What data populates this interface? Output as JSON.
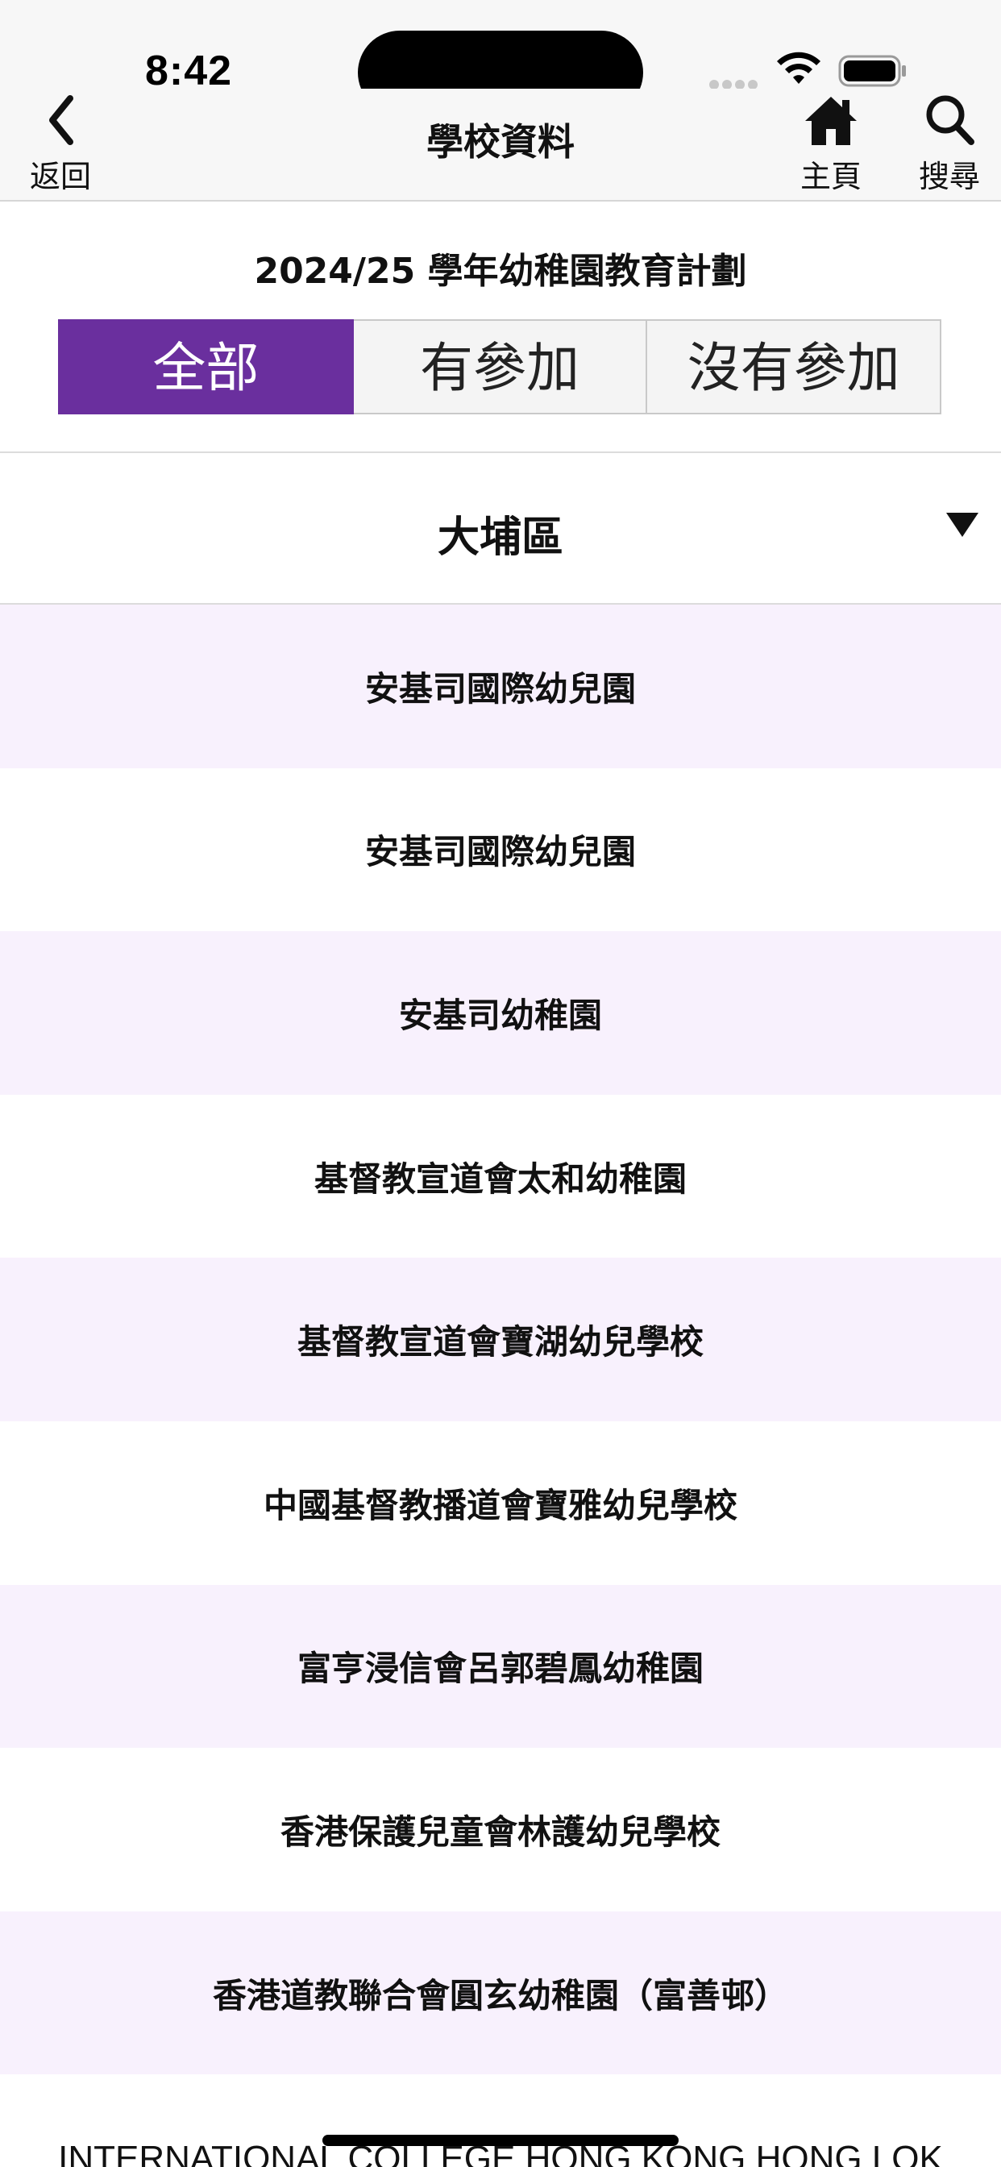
{
  "status_bar": {
    "time": "8:42"
  },
  "nav": {
    "back_label": "返回",
    "title": "學校資料",
    "home_label": "主頁",
    "search_label": "搜尋"
  },
  "plan_title": "2024/25 學年幼稚園教育計劃",
  "filter": {
    "segments": [
      {
        "label": "全部",
        "selected": true
      },
      {
        "label": "有參加",
        "selected": false
      },
      {
        "label": "沒有參加",
        "selected": false
      }
    ]
  },
  "district": {
    "selected": "大埔區"
  },
  "schools": [
    "安基司國際幼兒園",
    "安基司國際幼兒園",
    "安基司幼稚園",
    "基督教宣道會太和幼稚園",
    "基督教宣道會寶湖幼兒學校",
    "中國基督教播道會寶雅幼兒學校",
    "富亨浸信會呂郭碧鳳幼稚園",
    "香港保護兒童會林護幼兒學校",
    "香港道教聯合會圓玄幼稚園（富善邨）",
    "INTERNATIONAL COLLEGE HONG KONG HONG LOK"
  ],
  "colors": {
    "accent": "#6a2f9e",
    "row_alt": "#f8f1fd",
    "bar_bg": "#f7f7f7"
  }
}
